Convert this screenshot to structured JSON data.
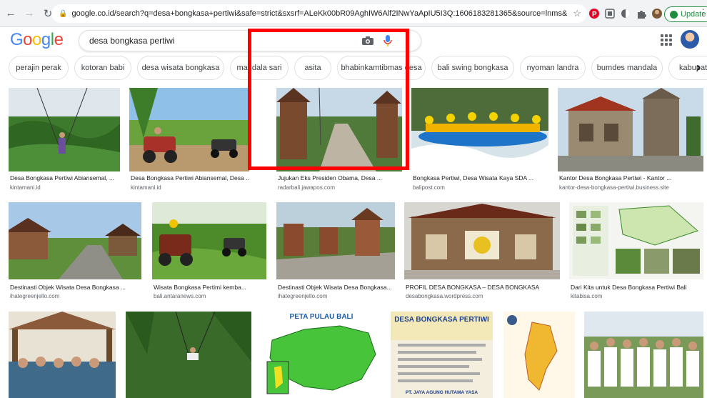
{
  "browser": {
    "url": "google.co.id/search?q=desa+bongkasa+pertiwi&safe=strict&sxsrf=ALeKk00bR09AghIW6Alf2INwYaApIU5I3Q:1606183281365&source=lnms&tbm=isch...",
    "update_label": "Update"
  },
  "google": {
    "logo": [
      "G",
      "o",
      "o",
      "g",
      "l",
      "e"
    ],
    "logo_colors": [
      "#4285f4",
      "#ea4335",
      "#fbbc05",
      "#4285f4",
      "#34a853",
      "#ea4335"
    ],
    "query": "desa bongkasa pertiwi"
  },
  "chips": [
    "perajin perak",
    "kotoran babi",
    "desa wisata bongkasa",
    "mandala sari",
    "asita",
    "bhabinkamtibmas desa",
    "bali swing bongkasa",
    "nyoman landra",
    "bumdes mandala",
    "kabupaten"
  ],
  "results": [
    {
      "caption": "Desa Bongkasa Pertiwi Abiansemal, ...",
      "source": "kintamani.id"
    },
    {
      "caption": "Desa Bongkasa Pertiwi Abiansemal, Desa ...",
      "source": "kintamani.id"
    },
    {
      "caption": "Jujukan Eks Presiden Obama, Desa ...",
      "source": "radarbali.jawapos.com"
    },
    {
      "caption": "Bongkasa Pertiwi, Desa Wisata Kaya SDA ...",
      "source": "balipost.com"
    },
    {
      "caption": "Kantor Desa Bongkasa Pertiwi - Kantor ...",
      "source": "kantor-desa-bongkasa-pertiwi.business.site"
    },
    {
      "caption": "Destinasti Objek Wisata Desa Bongkasa ...",
      "source": "ihategreenjello.com"
    },
    {
      "caption": "Wisata Bongkasa Pertimi kemba...",
      "source": "bali.antaranews.com"
    },
    {
      "caption": "Destinasti Objek Wisata Desa Bongkasa...",
      "source": "ihategreenjello.com"
    },
    {
      "caption": "PROFIL DESA BONGKASA – DESA BONGKASA",
      "source": "desabongkasa.wordpress.com"
    },
    {
      "caption": "Dari Kita untuk Desa Bongkasa Pertiwi Bali",
      "source": "kitabisa.com"
    }
  ],
  "image_texts": {
    "map_title": "PETA PULAU BALI",
    "doc_title": "DESA BONGKASA PERTIWI",
    "doc_footer": "PT. JAYA AGUNG HUTAMA YASA"
  },
  "colors": {
    "highlight": "#ff0000",
    "update_green": "#1e8e3e"
  }
}
